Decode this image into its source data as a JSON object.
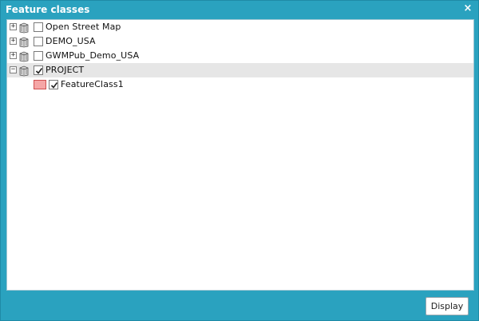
{
  "dialog": {
    "title": "Feature classes",
    "close_glyph": "×"
  },
  "tree": {
    "nodes": [
      {
        "label": "Open Street Map",
        "checked": false,
        "expanded": false
      },
      {
        "label": "DEMO_USA",
        "checked": false,
        "expanded": false
      },
      {
        "label": "GWMPub_Demo_USA",
        "checked": false,
        "expanded": false
      },
      {
        "label": "PROJECT",
        "checked": true,
        "expanded": true,
        "selected": true,
        "children": [
          {
            "label": "FeatureClass1",
            "checked": true,
            "swatch_color": "#f5a6a6"
          }
        ]
      }
    ]
  },
  "footer": {
    "display_label": "Display"
  },
  "colors": {
    "frame": "#2aa2bf",
    "selected_row": "#e6e6e6"
  }
}
